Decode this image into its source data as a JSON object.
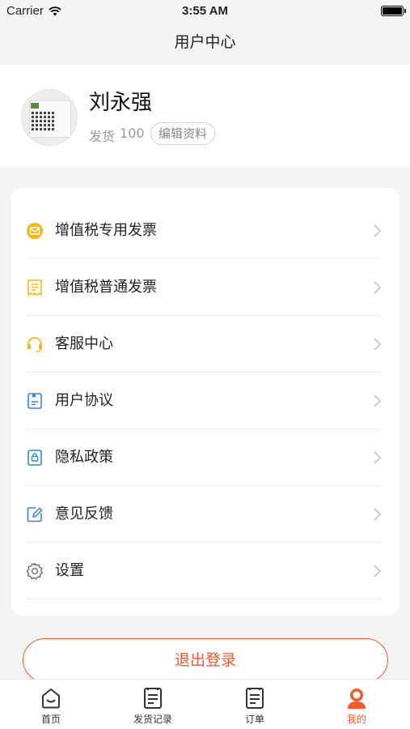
{
  "status_bar": {
    "carrier": "Carrier",
    "time": "3:55 AM"
  },
  "nav": {
    "title": "用户中心"
  },
  "profile": {
    "name": "刘永强",
    "shipped_label": "发货",
    "shipped_count": "100",
    "edit_label": "编辑资料"
  },
  "menu": {
    "items": [
      {
        "label": "增值税专用发票",
        "icon": "vat-special-invoice-icon"
      },
      {
        "label": "增值税普通发票",
        "icon": "vat-normal-invoice-icon"
      },
      {
        "label": "客服中心",
        "icon": "headset-icon"
      },
      {
        "label": "用户协议",
        "icon": "agreement-document-icon"
      },
      {
        "label": "隐私政策",
        "icon": "privacy-lock-icon"
      },
      {
        "label": "意见反馈",
        "icon": "feedback-pen-icon"
      },
      {
        "label": "设置",
        "icon": "gear-icon"
      }
    ]
  },
  "logout": {
    "label": "退出登录"
  },
  "tabs": [
    {
      "label": "首页",
      "icon": "home-icon"
    },
    {
      "label": "发货记录",
      "icon": "shipping-record-icon"
    },
    {
      "label": "订单",
      "icon": "order-icon"
    },
    {
      "label": "我的",
      "icon": "my-profile-icon",
      "active": true
    }
  ],
  "colors": {
    "accent": "#ee5b2e",
    "icon_yellow": "#f5b71b",
    "icon_blue": "#3b82d6",
    "background": "#f4f4f4"
  }
}
